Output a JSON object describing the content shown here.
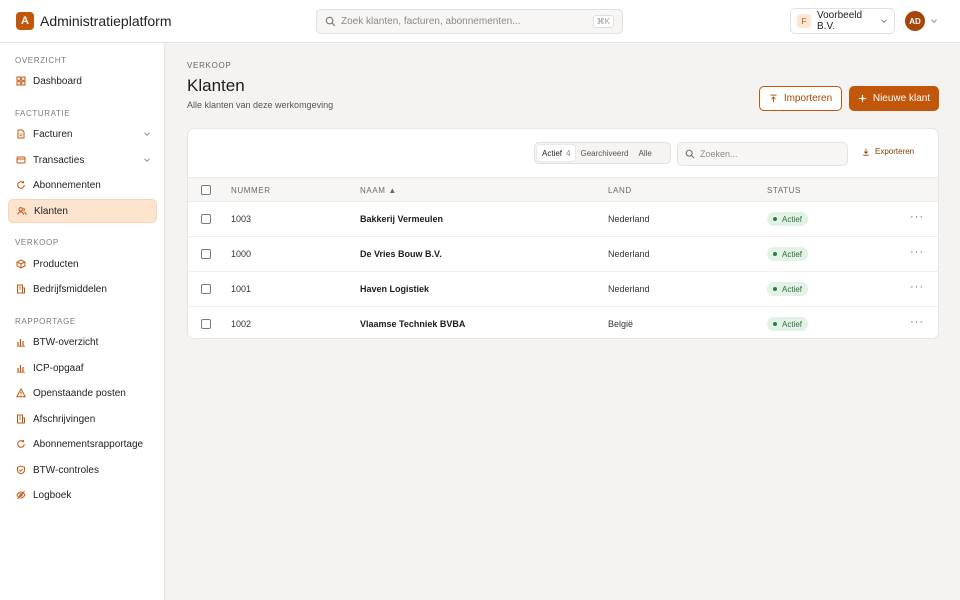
{
  "app": {
    "logo_letter": "A",
    "name": "Administratieplatform"
  },
  "search": {
    "placeholder": "Zoek klanten, facturen, abonnementen...",
    "shortcut": "⌘K"
  },
  "workspace": {
    "initial": "F",
    "name": "Voorbeeld B.V."
  },
  "user": {
    "initials": "AD"
  },
  "sidebar": {
    "sections": [
      {
        "label": "OVERZICHT",
        "items": [
          {
            "label": "Dashboard",
            "icon": "dashboard-icon"
          }
        ]
      },
      {
        "label": "FACTURATIE",
        "items": [
          {
            "label": "Facturen",
            "icon": "document-icon",
            "expandable": true
          },
          {
            "label": "Transacties",
            "icon": "card-icon",
            "expandable": true
          },
          {
            "label": "Abonnementen",
            "icon": "refresh-icon"
          },
          {
            "label": "Klanten",
            "icon": "users-icon",
            "active": true
          }
        ]
      },
      {
        "label": "VERKOOP",
        "items": [
          {
            "label": "Producten",
            "icon": "box-icon"
          },
          {
            "label": "Bedrijfsmiddelen",
            "icon": "building-icon"
          }
        ]
      },
      {
        "label": "RAPPORTAGE",
        "items": [
          {
            "label": "BTW-overzicht",
            "icon": "bar-chart-icon"
          },
          {
            "label": "ICP-opgaaf",
            "icon": "bar-chart-icon"
          },
          {
            "label": "Openstaande posten",
            "icon": "warning-icon"
          },
          {
            "label": "Afschrijvingen",
            "icon": "building-icon"
          },
          {
            "label": "Abonnementsrapportage",
            "icon": "refresh-icon"
          },
          {
            "label": "BTW-controles",
            "icon": "shield-icon"
          },
          {
            "label": "Logboek",
            "icon": "eye-off-icon"
          }
        ]
      }
    ]
  },
  "page": {
    "breadcrumb": "VERKOOP",
    "title": "Klanten",
    "subtitle": "Alle klanten van deze werkomgeving",
    "import_label": "Importeren",
    "new_label": "Nieuwe klant"
  },
  "filters": {
    "tabs": [
      {
        "label": "Actief",
        "count": "4",
        "active": true
      },
      {
        "label": "Gearchiveerd"
      },
      {
        "label": "Alle"
      }
    ],
    "search_placeholder": "Zoeken...",
    "export_label": "Exporteren"
  },
  "table": {
    "columns": [
      "NUMMER",
      "NAAM ▲",
      "LAND",
      "STATUS"
    ],
    "rows": [
      {
        "number": "1003",
        "name": "Bakkerij Vermeulen",
        "country": "Nederland",
        "status": "Actief"
      },
      {
        "number": "1000",
        "name": "De Vries Bouw B.V.",
        "country": "Nederland",
        "status": "Actief"
      },
      {
        "number": "1001",
        "name": "Haven Logistiek",
        "country": "Nederland",
        "status": "Actief"
      },
      {
        "number": "1002",
        "name": "Vlaamse Techniek BVBA",
        "country": "België",
        "status": "Actief"
      }
    ],
    "row_action": "···"
  },
  "colors": {
    "accent": "#c2570c",
    "active_bg": "#fde4cf",
    "status_bg": "#e3f2e6",
    "status_text": "#2c6e3c"
  }
}
